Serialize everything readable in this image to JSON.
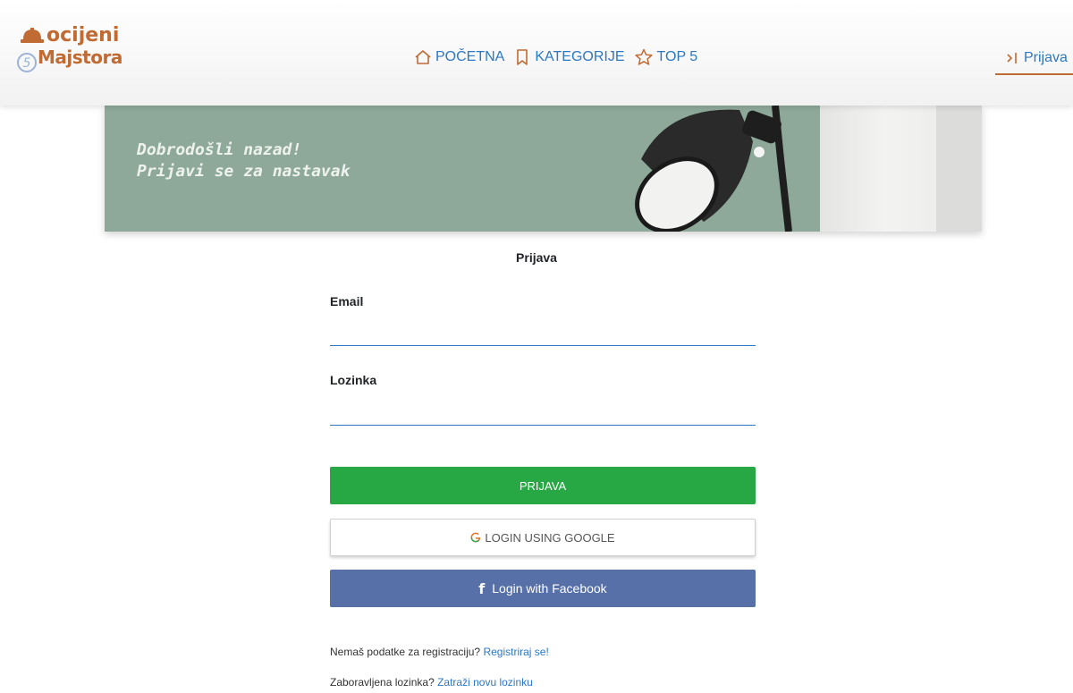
{
  "header": {
    "logo": {
      "line1": "ocijeni",
      "line2": "Majstora",
      "badge": "5"
    },
    "nav": [
      {
        "label": "POČETNA",
        "icon": "home-icon"
      },
      {
        "label": "KATEGORIJE",
        "icon": "bookmark-icon"
      },
      {
        "label": "TOP 5",
        "icon": "star-icon"
      }
    ],
    "login_link": {
      "label": "Prijava",
      "icon": "sign-in-icon"
    }
  },
  "banner": {
    "line1": "Dobrodošli nazad!",
    "line2": "Prijavi se za nastavak"
  },
  "form": {
    "title": "Prijava",
    "email_label": "Email",
    "email_value": "",
    "password_label": "Lozinka",
    "password_value": "",
    "submit_label": "PRIJAVA",
    "google_label": "LOGIN USING GOOGLE",
    "facebook_label": "Login with Facebook"
  },
  "links": {
    "register_text": "Nemaš podatke za registraciju?",
    "register_link": "Registriraj se!",
    "forgot_text": "Zaboravljena lozinka?",
    "forgot_link": "Zatraži novu lozinku"
  },
  "colors": {
    "brand": "#c06a34",
    "link": "#2d78c2",
    "primary_button": "#28a745",
    "facebook": "#5870a8",
    "banner_bg": "#8ea89a"
  }
}
